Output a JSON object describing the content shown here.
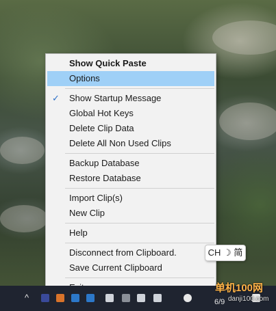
{
  "menu": {
    "items": [
      {
        "label": "Show Quick Paste"
      },
      {
        "label": "Options"
      },
      {
        "label": "Show Startup Message",
        "checked": true
      },
      {
        "label": "Global Hot Keys"
      },
      {
        "label": "Delete Clip Data"
      },
      {
        "label": "Delete All Non Used Clips"
      },
      {
        "label": "Backup Database"
      },
      {
        "label": "Restore Database"
      },
      {
        "label": "Import Clip(s)"
      },
      {
        "label": "New Clip"
      },
      {
        "label": "Help"
      },
      {
        "label": "Disconnect from Clipboard."
      },
      {
        "label": "Save Current Clipboard"
      },
      {
        "label": "Exit"
      }
    ],
    "check_glyph": "✓",
    "selected_color": "#9fd0f7"
  },
  "ime": {
    "label": "CH ☽ 简"
  },
  "taskbar": {
    "chevron": "^",
    "clock_date": "6/9",
    "watermark": "单机100网",
    "watermark_url": "danji100.com"
  }
}
